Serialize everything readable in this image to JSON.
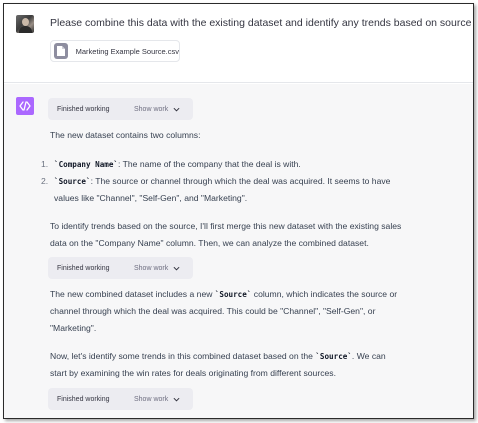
{
  "user_message": {
    "text": "Please combine this data with the existing dataset and identify any trends based on source",
    "attachment": {
      "file_name": "Marketing Example Source.csv",
      "icon": "file-icon"
    }
  },
  "assistant": {
    "icon": "code-brackets-icon",
    "accent_color": "#ab68ff",
    "work_pills": [
      {
        "label": "Finished working",
        "action": "Show work"
      },
      {
        "label": "Finished working",
        "action": "Show work"
      },
      {
        "label": "Finished working",
        "action": "Show work"
      }
    ],
    "intro": "The new dataset contains two columns:",
    "list": [
      {
        "num": "1.",
        "code": "`Company Name`",
        "text": ": The name of the company that the deal is with."
      },
      {
        "num": "2.",
        "code": "`Source`",
        "text": ": The source or channel through which the deal was acquired. It seems to have",
        "cont": "values like \"Channel\", \"Self-Gen\", and \"Marketing\"."
      }
    ],
    "para2": [
      "To identify trends based on the source, I'll first merge this new dataset with the existing sales",
      "data on the \"Company Name\" column. Then, we can analyze the combined dataset."
    ],
    "para3": {
      "line1_pre": "The new combined dataset includes a new ",
      "line1_code": "`Source`",
      "line1_post": " column, which indicates the source or",
      "line2": "channel through which the deal was acquired. This could be \"Channel\", \"Self-Gen\", or",
      "line3": "\"Marketing\"."
    },
    "para4": {
      "line1_pre": "Now, let's identify some trends in this combined dataset based on the ",
      "line1_code": "`Source`",
      "line1_post": ". We can",
      "line2": "start by examining the win rates for deals originating from different sources."
    }
  }
}
